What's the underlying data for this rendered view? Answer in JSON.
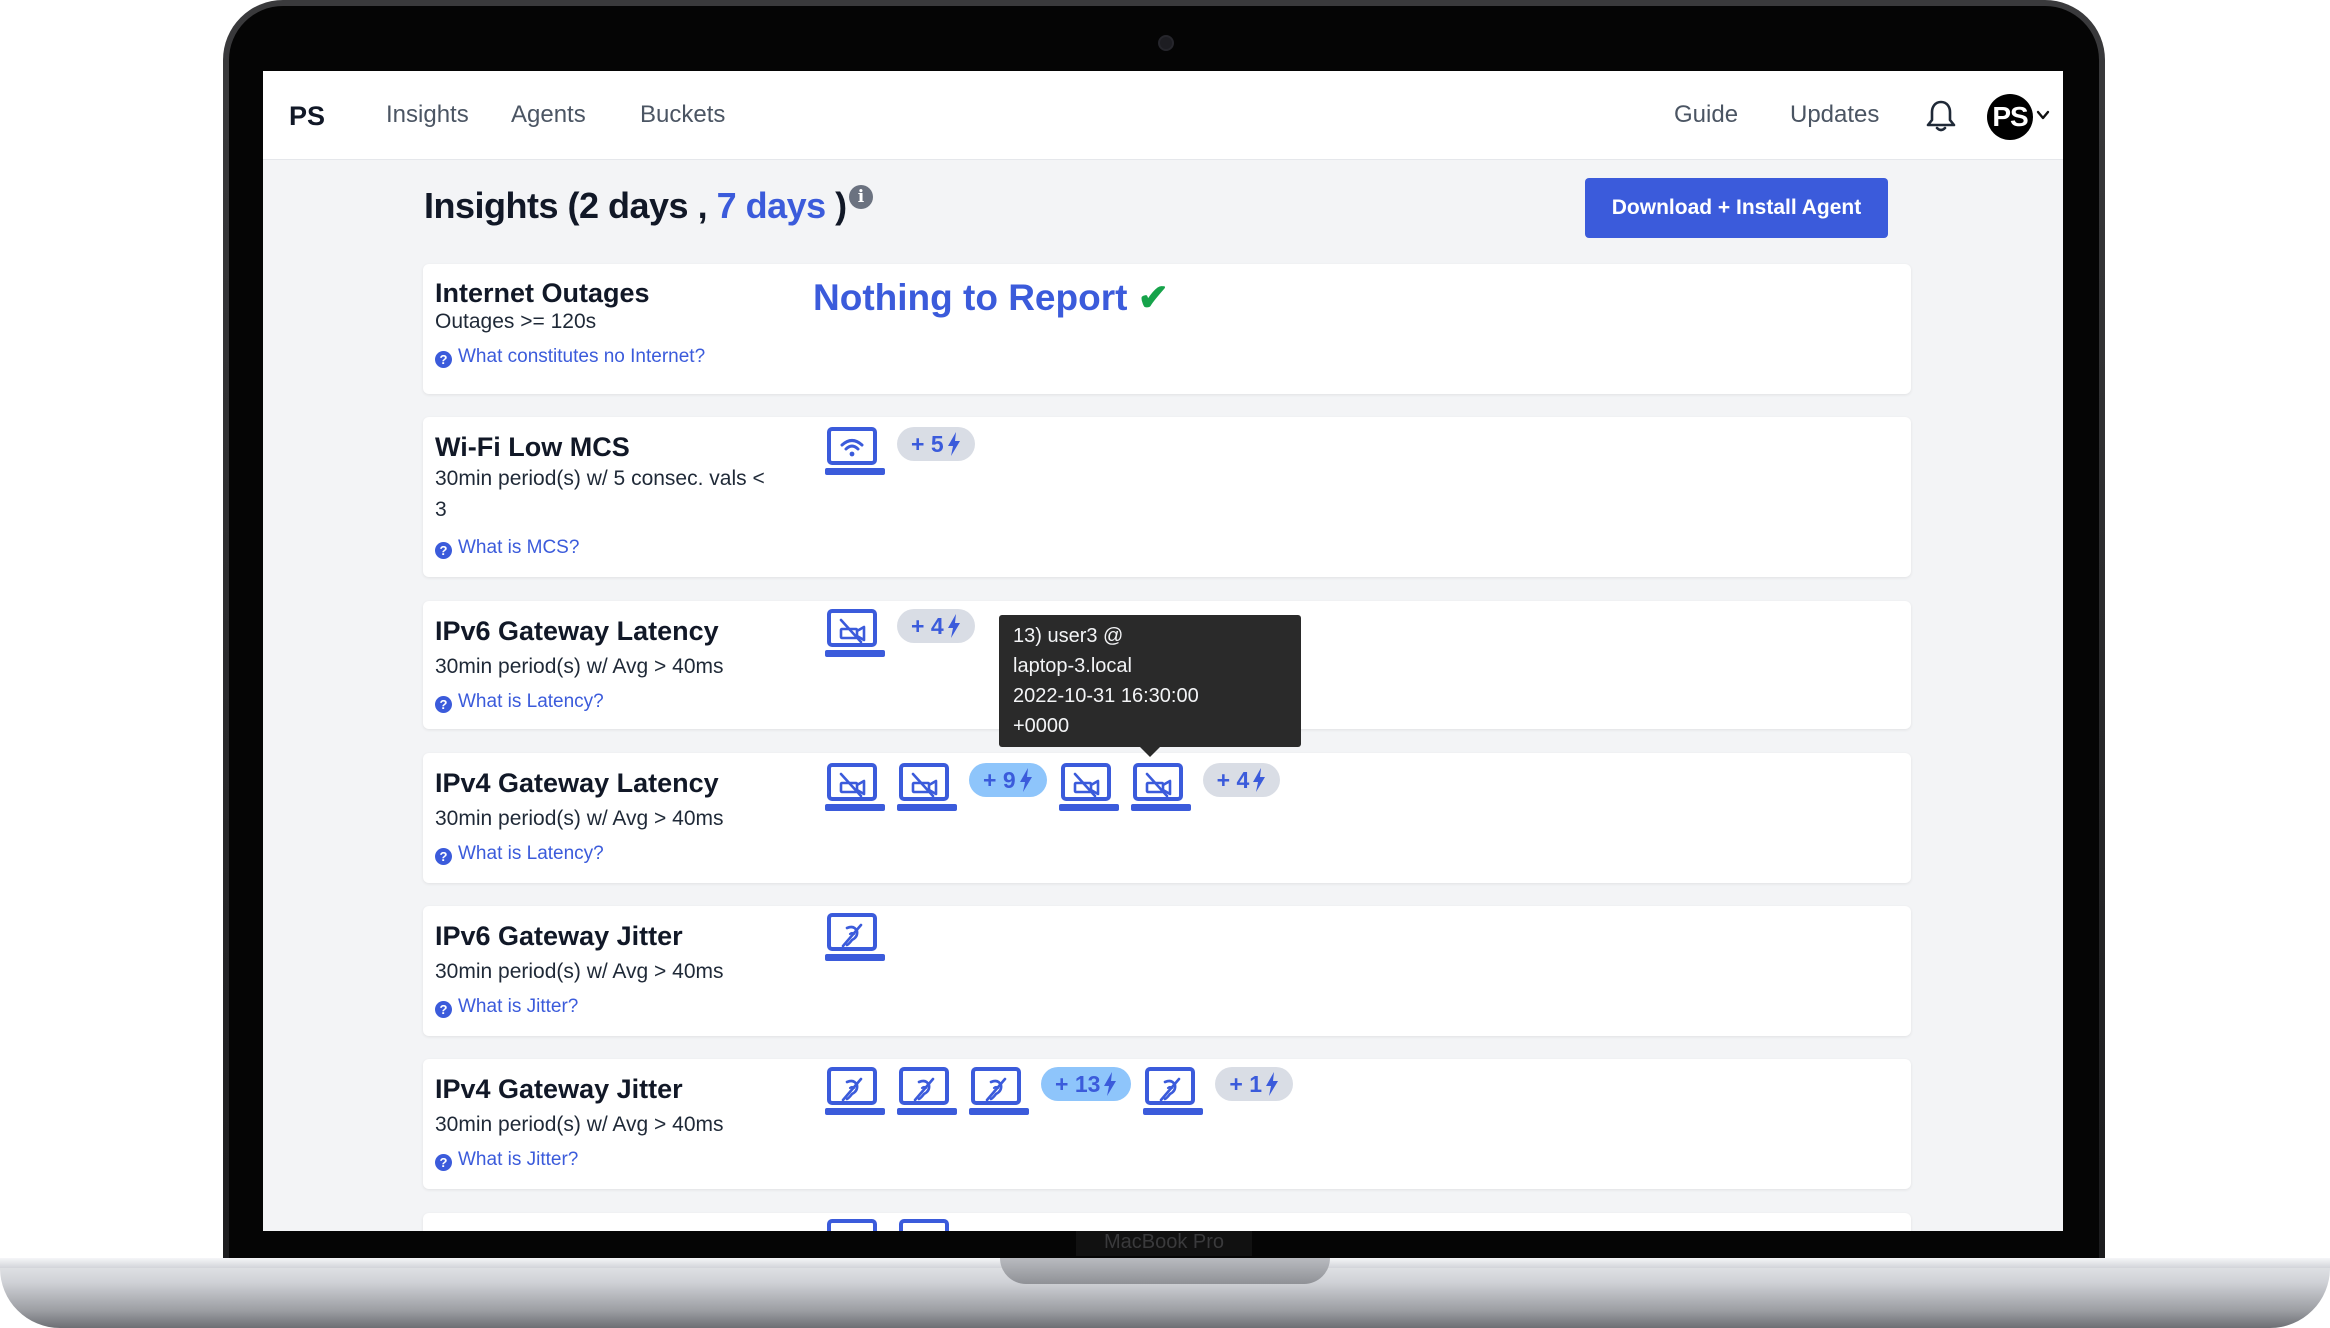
{
  "device": {
    "brand_label": "MacBook Pro"
  },
  "nav": {
    "logo": "PS",
    "links": [
      "Insights",
      "Agents",
      "Buckets"
    ],
    "right_links": [
      "Guide",
      "Updates"
    ],
    "avatar_initials": "PS",
    "icons": [
      "bell-icon",
      "chevron-down-icon"
    ]
  },
  "header": {
    "title_prefix": "Insights (",
    "range_a": "2 days",
    "separator": " , ",
    "range_b": "7 days",
    "title_suffix": " )",
    "info_glyph": "i",
    "download_button": "Download + Install Agent"
  },
  "colors": {
    "accent": "#3b5bdb",
    "check": "#16a34a",
    "badge_grey": "#d9dde5",
    "badge_blue": "#8ec5fb"
  },
  "cards": [
    {
      "title": "Internet Outages",
      "desc": "Outages >= 120s",
      "help": "What constitutes no Internet?",
      "report": "Nothing to Report",
      "check": "✔"
    },
    {
      "title": "Wi-Fi Low MCS",
      "desc": "30min period(s) w/ 5 consec. vals < 3",
      "help": "What is MCS?",
      "icon_type": "wifi",
      "items": [
        {
          "type": "laptop"
        },
        {
          "type": "badge",
          "text": "+ 5",
          "style": "grey"
        }
      ]
    },
    {
      "title": "IPv6 Gateway Latency",
      "desc": "30min period(s) w/ Avg > 40ms",
      "help": "What is Latency?",
      "icon_type": "latency",
      "items": [
        {
          "type": "laptop"
        },
        {
          "type": "badge",
          "text": "+ 4",
          "style": "grey"
        }
      ]
    },
    {
      "title": "IPv4 Gateway Latency",
      "desc": "30min period(s) w/ Avg > 40ms",
      "help": "What is Latency?",
      "icon_type": "latency",
      "items": [
        {
          "type": "laptop"
        },
        {
          "type": "laptop"
        },
        {
          "type": "badge",
          "text": "+ 9",
          "style": "blue"
        },
        {
          "type": "laptop"
        },
        {
          "type": "laptop"
        },
        {
          "type": "badge",
          "text": "+ 4",
          "style": "grey"
        }
      ]
    },
    {
      "title": "IPv6 Gateway Jitter",
      "desc": "30min period(s) w/ Avg > 40ms",
      "help": "What is Jitter?",
      "icon_type": "jitter",
      "items": [
        {
          "type": "laptop"
        }
      ]
    },
    {
      "title": "IPv4 Gateway Jitter",
      "desc": "30min period(s) w/ Avg > 40ms",
      "help": "What is Jitter?",
      "icon_type": "jitter",
      "items": [
        {
          "type": "laptop"
        },
        {
          "type": "laptop"
        },
        {
          "type": "laptop"
        },
        {
          "type": "badge",
          "text": "+ 13",
          "style": "blue"
        },
        {
          "type": "laptop"
        },
        {
          "type": "badge",
          "text": "+ 1",
          "style": "grey"
        }
      ]
    }
  ],
  "tooltip": {
    "lines": [
      "13) user3 @",
      "laptop-3.local",
      "2022-10-31 16:30:00",
      "+0000"
    ]
  }
}
